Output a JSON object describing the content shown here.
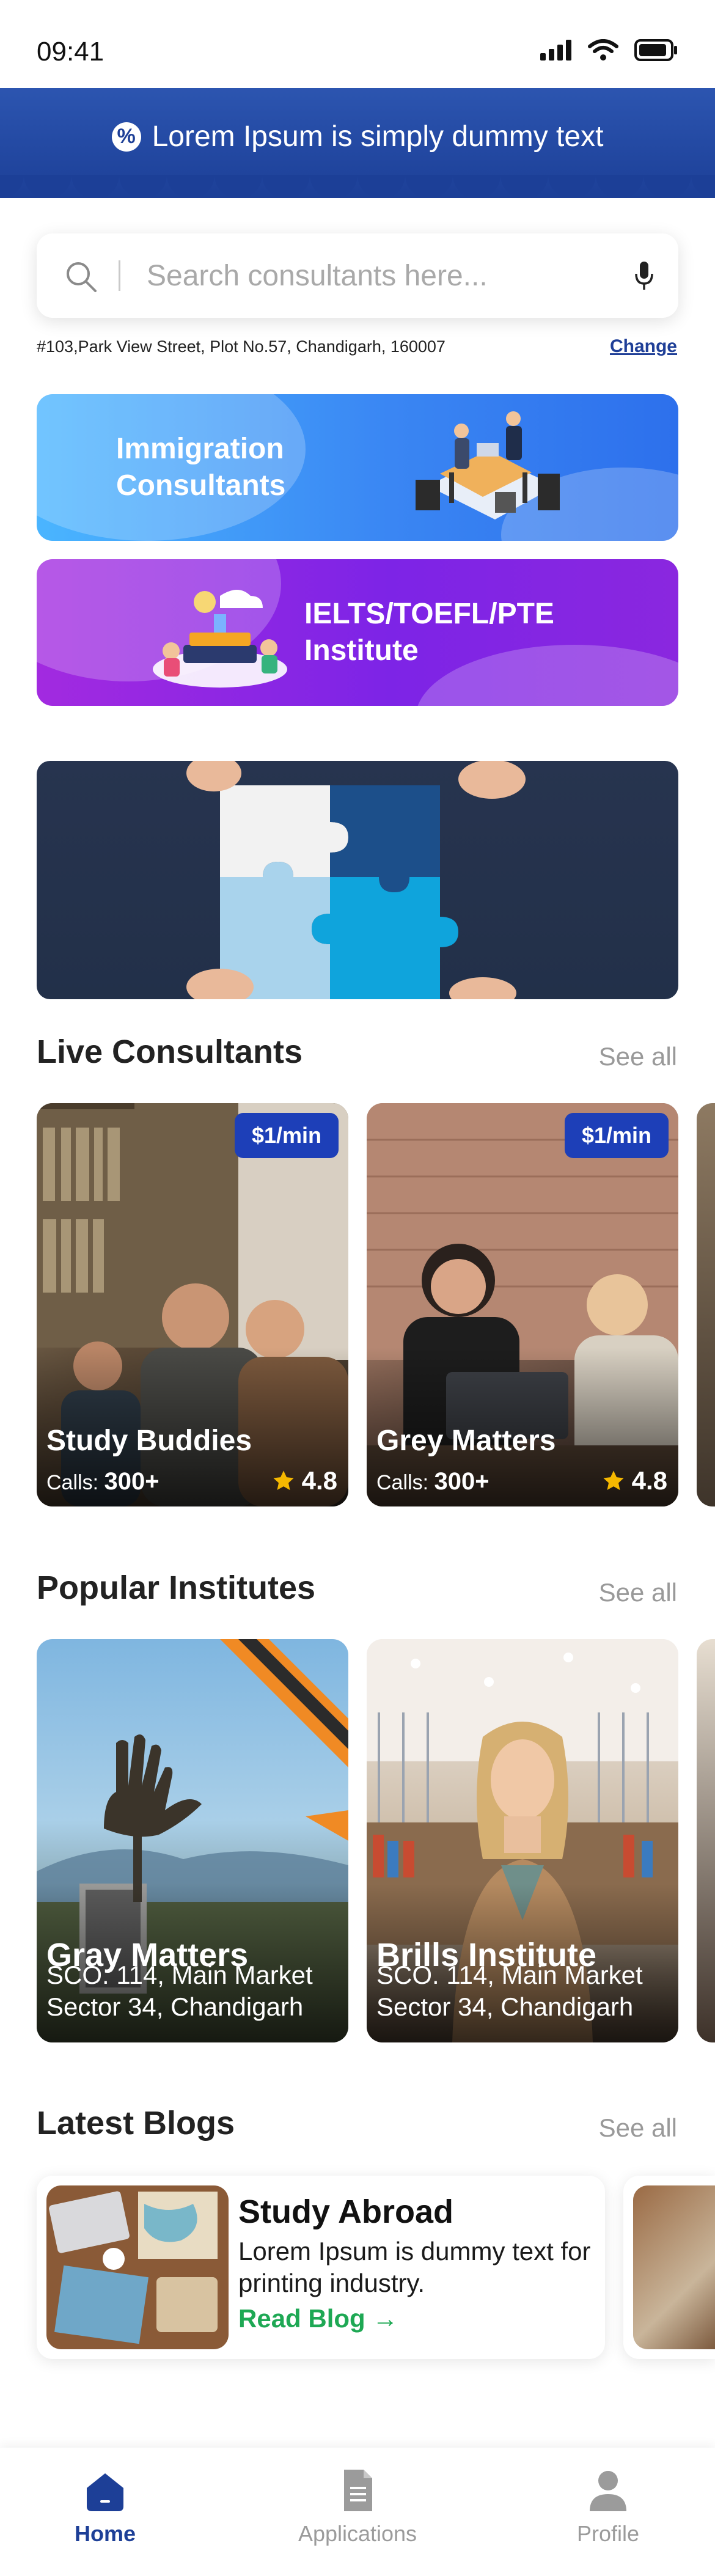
{
  "status_bar": {
    "time": "09:41"
  },
  "promo": {
    "text": "Lorem Ipsum is simply dummy text",
    "icon": "percent-badge-icon",
    "bg_color": "#1d3f97"
  },
  "search": {
    "placeholder": "Search consultants here...",
    "value": ""
  },
  "location": {
    "address": "#103,Park View Street, Plot No.57, Chandigarh, 160007",
    "change_label": "Change"
  },
  "categories": [
    {
      "label_line1": "Immigration",
      "label_line2": "Consultants",
      "color": "#3a86f3"
    },
    {
      "label_line1": "IELTS/TOEFL/PTE",
      "label_line2": "Institute",
      "color": "#8a27df"
    }
  ],
  "live_consultants": {
    "title": "Live Consultants",
    "see_all": "See all",
    "items": [
      {
        "price": "$1/min",
        "name": "Study Buddies",
        "calls_label": "Calls:",
        "calls_value": "300+",
        "rating": "4.8"
      },
      {
        "price": "$1/min",
        "name": "Grey Matters",
        "calls_label": "Calls:",
        "calls_value": "300+",
        "rating": "4.8"
      }
    ]
  },
  "popular_institutes": {
    "title": "Popular Institutes",
    "see_all": "See all",
    "items": [
      {
        "name": "Gray Matters",
        "address_line1": "SCO. 114, Main Market",
        "address_line2": "Sector 34, Chandigarh"
      },
      {
        "name": "Brills Institute",
        "address_line1": "SCO. 114, Main Market",
        "address_line2": "Sector 34, Chandigarh"
      }
    ]
  },
  "latest_blogs": {
    "title": "Latest Blogs",
    "see_all": "See all",
    "items": [
      {
        "title": "Study Abroad",
        "description": "Lorem Ipsum is dummy text for printing industry.",
        "link": "Read Blog →"
      }
    ]
  },
  "tab_bar": {
    "tabs": [
      {
        "label": "Home",
        "icon": "home-icon",
        "active": true
      },
      {
        "label": "Applications",
        "icon": "document-icon",
        "active": false
      },
      {
        "label": "Profile",
        "icon": "person-icon",
        "active": false
      }
    ],
    "active_color": "#1d3f97",
    "inactive_color": "#9b9b9b"
  },
  "colors": {
    "accent": "#1d3f97",
    "star": "#f5b800",
    "read_link": "#1ea854"
  }
}
